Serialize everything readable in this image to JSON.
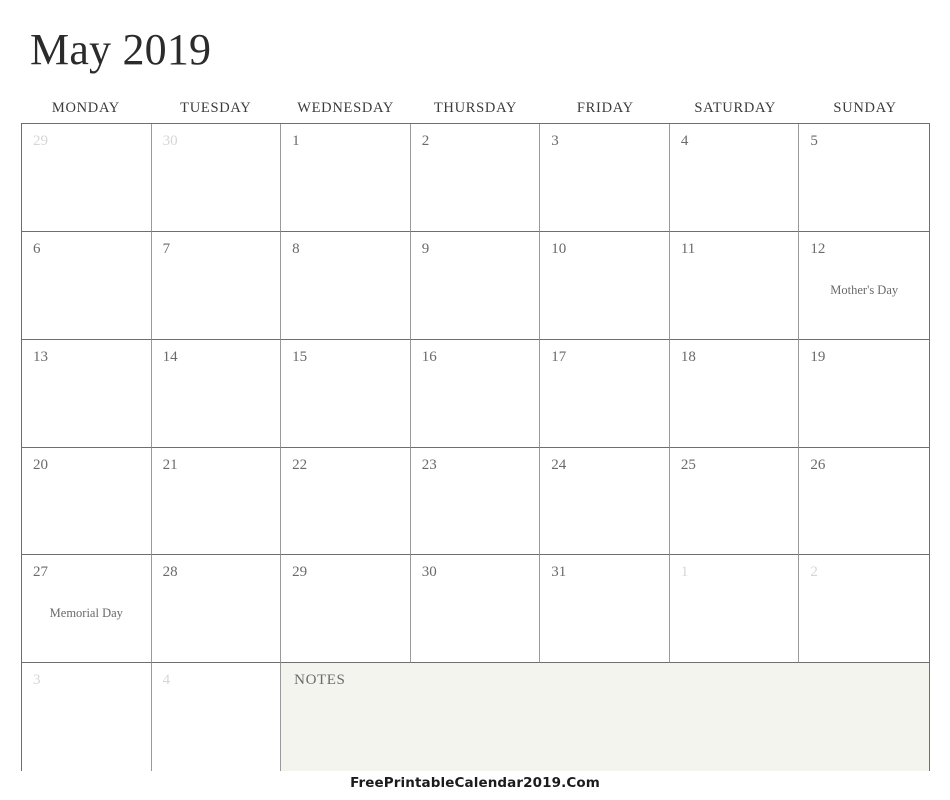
{
  "title": "May 2019",
  "weekdays": [
    "MONDAY",
    "TUESDAY",
    "WEDNESDAY",
    "THURSDAY",
    "FRIDAY",
    "SATURDAY",
    "SUNDAY"
  ],
  "notes": {
    "label": "NOTES",
    "background": "#f4f4ee"
  },
  "footer": {
    "credit": "FreePrintableCalendar2019.Com"
  },
  "colors": {
    "title": "#2b2b2b",
    "weekday": "#3a3a3a",
    "day_number": "#6a6a6a",
    "day_number_muted": "#d6d6d6",
    "grid_line": "#6f6f6f",
    "notes_background": "#f4f4ee",
    "page_background": "#ffffff"
  },
  "weeks": [
    [
      {
        "day": "29",
        "muted": true,
        "event": ""
      },
      {
        "day": "30",
        "muted": true,
        "event": ""
      },
      {
        "day": "1",
        "muted": false,
        "event": ""
      },
      {
        "day": "2",
        "muted": false,
        "event": ""
      },
      {
        "day": "3",
        "muted": false,
        "event": ""
      },
      {
        "day": "4",
        "muted": false,
        "event": ""
      },
      {
        "day": "5",
        "muted": false,
        "event": ""
      }
    ],
    [
      {
        "day": "6",
        "muted": false,
        "event": ""
      },
      {
        "day": "7",
        "muted": false,
        "event": ""
      },
      {
        "day": "8",
        "muted": false,
        "event": ""
      },
      {
        "day": "9",
        "muted": false,
        "event": ""
      },
      {
        "day": "10",
        "muted": false,
        "event": ""
      },
      {
        "day": "11",
        "muted": false,
        "event": ""
      },
      {
        "day": "12",
        "muted": false,
        "event": "Mother's Day"
      }
    ],
    [
      {
        "day": "13",
        "muted": false,
        "event": ""
      },
      {
        "day": "14",
        "muted": false,
        "event": ""
      },
      {
        "day": "15",
        "muted": false,
        "event": ""
      },
      {
        "day": "16",
        "muted": false,
        "event": ""
      },
      {
        "day": "17",
        "muted": false,
        "event": ""
      },
      {
        "day": "18",
        "muted": false,
        "event": ""
      },
      {
        "day": "19",
        "muted": false,
        "event": ""
      }
    ],
    [
      {
        "day": "20",
        "muted": false,
        "event": ""
      },
      {
        "day": "21",
        "muted": false,
        "event": ""
      },
      {
        "day": "22",
        "muted": false,
        "event": ""
      },
      {
        "day": "23",
        "muted": false,
        "event": ""
      },
      {
        "day": "24",
        "muted": false,
        "event": ""
      },
      {
        "day": "25",
        "muted": false,
        "event": ""
      },
      {
        "day": "26",
        "muted": false,
        "event": ""
      }
    ],
    [
      {
        "day": "27",
        "muted": false,
        "event": "Memorial Day"
      },
      {
        "day": "28",
        "muted": false,
        "event": ""
      },
      {
        "day": "29",
        "muted": false,
        "event": ""
      },
      {
        "day": "30",
        "muted": false,
        "event": ""
      },
      {
        "day": "31",
        "muted": false,
        "event": ""
      },
      {
        "day": "1",
        "muted": true,
        "event": ""
      },
      {
        "day": "2",
        "muted": true,
        "event": ""
      }
    ],
    [
      {
        "day": "3",
        "muted": true,
        "event": ""
      },
      {
        "day": "4",
        "muted": true,
        "event": ""
      }
    ]
  ]
}
